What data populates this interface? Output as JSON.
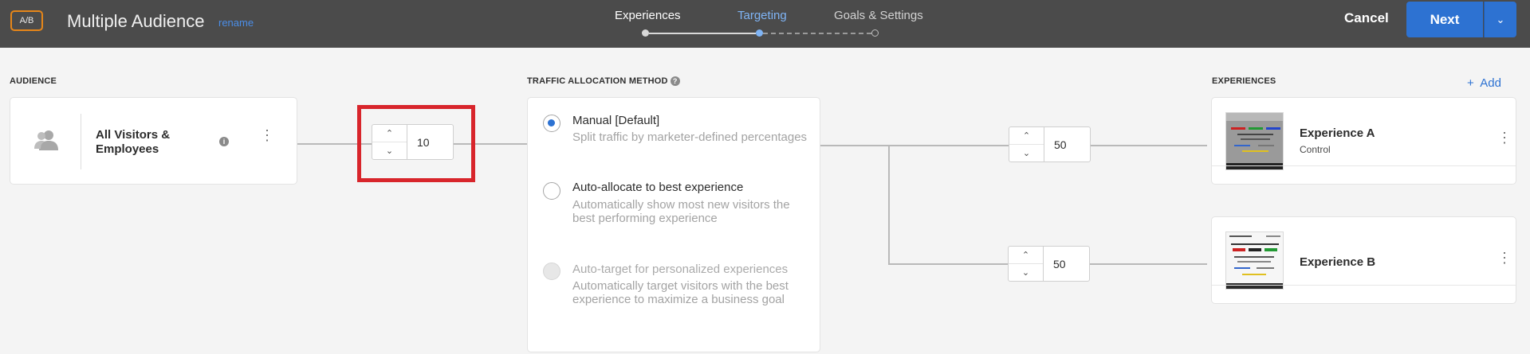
{
  "header": {
    "badge": "A/B",
    "title": "Multiple Audience",
    "rename": "rename",
    "steps": [
      "Experiences",
      "Targeting",
      "Goals & Settings"
    ],
    "active_step": "Targeting",
    "cancel": "Cancel",
    "next": "Next"
  },
  "audience": {
    "section_label": "AUDIENCE",
    "name": "All Visitors & Employees",
    "traffic_value": "10"
  },
  "traffic": {
    "section_label": "TRAFFIC ALLOCATION METHOD",
    "options": [
      {
        "title": "Manual [Default]",
        "desc": "Split traffic by marketer-defined percentages",
        "selected": true,
        "disabled": false
      },
      {
        "title": "Auto-allocate to best experience",
        "desc": "Automatically show most new visitors the best performing experience",
        "selected": false,
        "disabled": false
      },
      {
        "title": "Auto-target for personalized experiences",
        "desc": "Automatically target visitors with the best experience to maximize a business goal",
        "selected": false,
        "disabled": true
      }
    ]
  },
  "experiences": {
    "section_label": "EXPERIENCES",
    "add_label": "Add",
    "items": [
      {
        "name": "Experience A",
        "subtitle": "Control",
        "allocation": "50"
      },
      {
        "name": "Experience B",
        "subtitle": "",
        "allocation": "50"
      }
    ]
  },
  "colors": {
    "header_bg": "#4b4b4b",
    "accent": "#2d72d2",
    "badge_border": "#e68619",
    "highlight": "#d8252b"
  }
}
